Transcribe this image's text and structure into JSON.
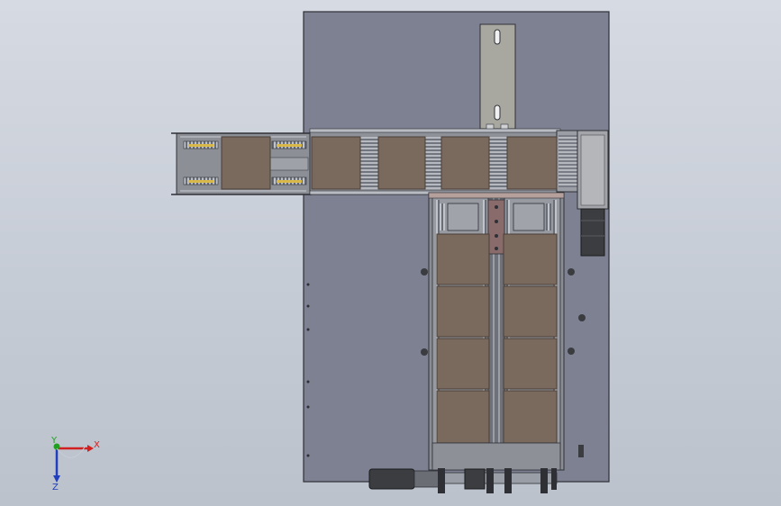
{
  "viewport": {
    "colors": {
      "background_top": "#d6dae2",
      "background_bottom": "#bcc2cc",
      "base_plate": "#7e8192",
      "box": "#7a6a5e",
      "box_edge": "#4a3f37",
      "metal": "#9a9ea6",
      "dark": "#2e3036",
      "pusher_plate": "#a8a8a0",
      "gear_motor": "#3b3d40",
      "linkage": "#8a6b6b"
    }
  },
  "triad": {
    "x_label": "X",
    "y_label": "Y",
    "z_label": "Z",
    "x_color": "#d22020",
    "y_color": "#20a020",
    "z_color": "#1f3fbf"
  }
}
